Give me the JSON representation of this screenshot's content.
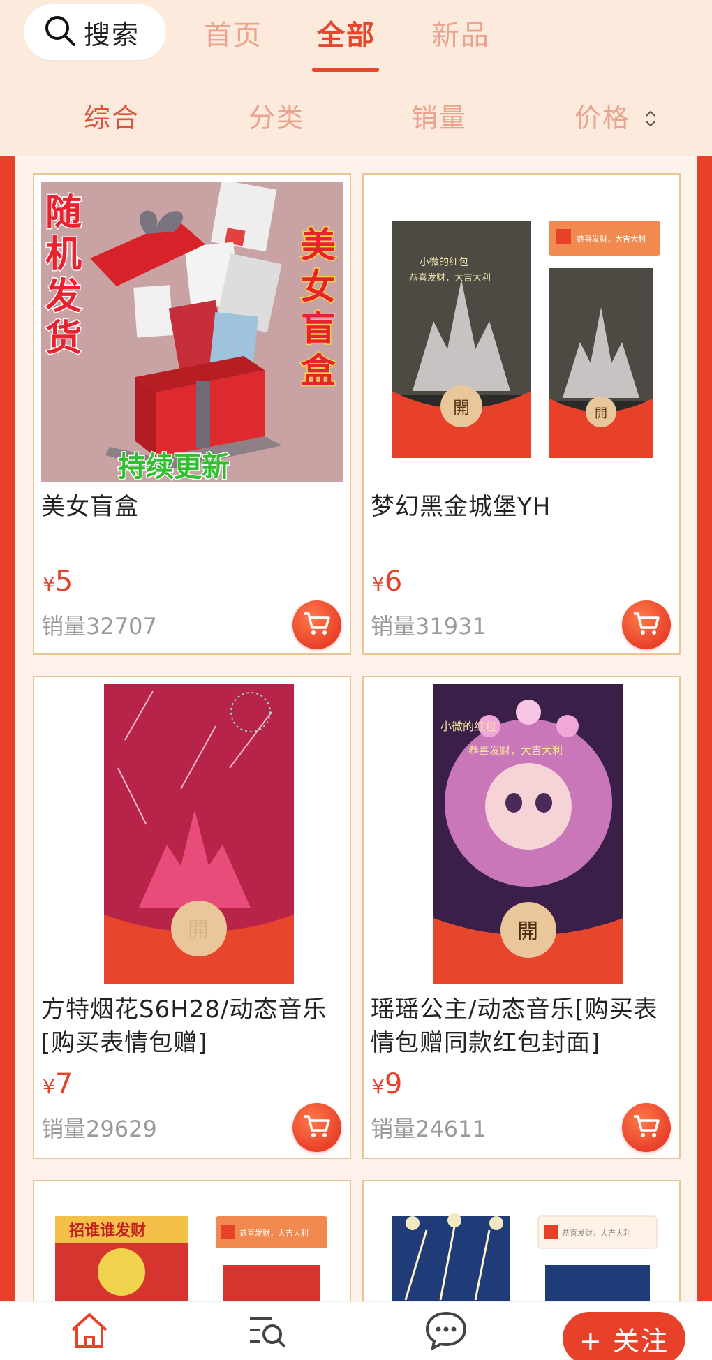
{
  "header": {
    "search_label": "搜索",
    "tabs": [
      {
        "label": "首页",
        "active": false
      },
      {
        "label": "全部",
        "active": true
      },
      {
        "label": "新品",
        "active": false
      }
    ]
  },
  "sort_bar": {
    "options": [
      "综合",
      "分类",
      "销量",
      "价格"
    ],
    "active_index": 0
  },
  "products": [
    {
      "title": "美女盲盒",
      "currency": "¥",
      "price": "5",
      "sales": "销量32707",
      "image_text": {
        "left": [
          "随",
          "机",
          "发",
          "货"
        ],
        "right": [
          "美",
          "女",
          "盲",
          "盒"
        ],
        "bottom": "持续更新"
      }
    },
    {
      "title": "梦幻黑金城堡YH",
      "currency": "¥",
      "price": "6",
      "sales": "销量31931",
      "image_text": {
        "open": "開",
        "brand": "小微的红包",
        "blessing": "恭喜发财，大吉大利"
      }
    },
    {
      "title": "方特烟花S6H28/动态音乐[购买表情包赠]",
      "currency": "¥",
      "price": "7",
      "sales": "销量29629",
      "image_text": {
        "open": "開"
      }
    },
    {
      "title": "瑶瑶公主/动态音乐[购买表情包赠同款红包封面]",
      "currency": "¥",
      "price": "9",
      "sales": "销量24611",
      "image_text": {
        "open": "開",
        "brand": "小微的红包",
        "blessing": "恭喜发财，大吉大利"
      }
    },
    {
      "title": "",
      "image_text": {
        "banner": "招谁谁发财",
        "blessing": "恭喜发财，大吉大利"
      }
    },
    {
      "title": "",
      "image_text": {
        "blessing": "恭喜发财，大吉大利"
      }
    }
  ],
  "bottom_bar": {
    "follow_label": "+ 关注",
    "icons": [
      "home-icon",
      "list-search-icon",
      "chat-icon"
    ]
  },
  "colors": {
    "accent": "#e8412a",
    "tab_inactive": "#e9a38e",
    "background": "#fcebdc",
    "card_border": "#e9c690"
  }
}
